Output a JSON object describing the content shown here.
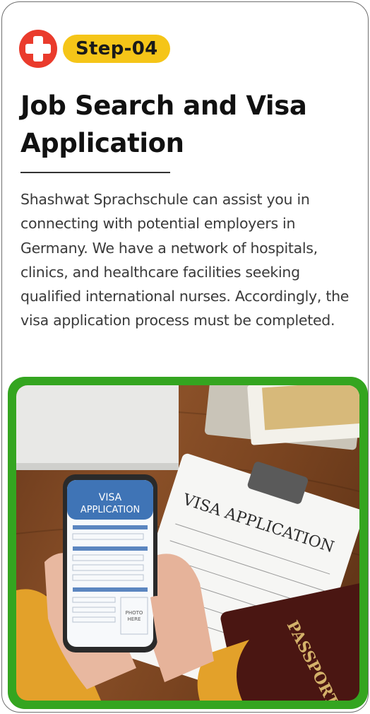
{
  "step": {
    "label": "Step-04"
  },
  "title": "Job Search and Visa Application",
  "description": "Shashwat Sprachschule can assist you in connecting with potential employers in Germany. We have a network of hospitals, clinics, and healthcare facilities seeking qualified international nurses. Accordingly, the visa application process must be completed.",
  "photo": {
    "phone_heading_1": "VISA",
    "phone_heading_2": "APPLICATION",
    "phone_photo_1": "PHOTO",
    "phone_photo_2": "HERE",
    "document_heading": "VISA APPLICATION",
    "passport_text": "PASSPORT"
  },
  "colors": {
    "accent_green": "#34a520",
    "badge_yellow": "#f5c518",
    "logo_red": "#ea3b2c"
  }
}
